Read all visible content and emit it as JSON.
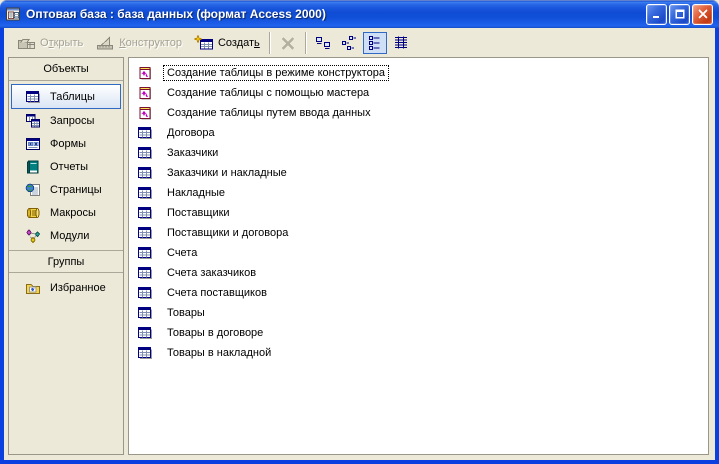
{
  "window": {
    "title": "Оптовая база : база данных (формат Access 2000)",
    "icons": {
      "app": "db-window-icon",
      "minimize": "minimize-icon",
      "maximize": "maximize-icon",
      "close": "close-icon"
    }
  },
  "toolbar": {
    "open": {
      "pre": "О",
      "accel": "т",
      "post": "крыть",
      "disabled": true,
      "icon": "open-table-icon"
    },
    "design": {
      "pre": "",
      "accel": "К",
      "post": "онструктор",
      "disabled": true,
      "icon": "design-view-icon"
    },
    "create": {
      "pre": "Создат",
      "accel": "ь",
      "post": "",
      "disabled": false,
      "icon": "new-object-icon"
    },
    "delete": {
      "disabled": true,
      "icon": "delete-x-icon"
    },
    "view_buttons": [
      {
        "name": "large-icons",
        "pressed": false
      },
      {
        "name": "small-icons",
        "pressed": false
      },
      {
        "name": "list",
        "pressed": true
      },
      {
        "name": "details",
        "pressed": false
      }
    ]
  },
  "sidebar": {
    "objects_header": "Объекты",
    "groups_header": "Группы",
    "items": [
      {
        "label": "Таблицы",
        "icon": "table-icon",
        "selected": true
      },
      {
        "label": "Запросы",
        "icon": "queries-icon",
        "selected": false
      },
      {
        "label": "Формы",
        "icon": "forms-icon",
        "selected": false
      },
      {
        "label": "Отчеты",
        "icon": "reports-icon",
        "selected": false
      },
      {
        "label": "Страницы",
        "icon": "pages-icon",
        "selected": false
      },
      {
        "label": "Макросы",
        "icon": "macros-icon",
        "selected": false
      },
      {
        "label": "Модули",
        "icon": "modules-icon",
        "selected": false
      }
    ],
    "group_items": [
      {
        "label": "Избранное",
        "icon": "favorites-folder-icon"
      }
    ]
  },
  "main": {
    "items": [
      {
        "label": "Создание таблицы в режиме конструктора",
        "icon": "new-table-wizard-icon",
        "focused": true
      },
      {
        "label": "Создание таблицы с помощью мастера",
        "icon": "new-table-wizard-icon",
        "focused": false
      },
      {
        "label": "Создание таблицы путем ввода данных",
        "icon": "new-table-wizard-icon",
        "focused": false
      },
      {
        "label": "Договора",
        "icon": "table-icon",
        "focused": false
      },
      {
        "label": "Заказчики",
        "icon": "table-icon",
        "focused": false
      },
      {
        "label": "Заказчики и накладные",
        "icon": "table-icon",
        "focused": false
      },
      {
        "label": "Накладные",
        "icon": "table-icon",
        "focused": false
      },
      {
        "label": "Поставщики",
        "icon": "table-icon",
        "focused": false
      },
      {
        "label": "Поставщики и договора",
        "icon": "table-icon",
        "focused": false
      },
      {
        "label": "Счета",
        "icon": "table-icon",
        "focused": false
      },
      {
        "label": "Счета заказчиков",
        "icon": "table-icon",
        "focused": false
      },
      {
        "label": "Счета поставщиков",
        "icon": "table-icon",
        "focused": false
      },
      {
        "label": "Товары",
        "icon": "table-icon",
        "focused": false
      },
      {
        "label": "Товары в договоре",
        "icon": "table-icon",
        "focused": false
      },
      {
        "label": "Товары в накладной",
        "icon": "table-icon",
        "focused": false
      }
    ]
  },
  "colors": {
    "titlebar_blue": "#1a57dd",
    "frame_blue": "#0c3fe0",
    "chrome_beige": "#ece9d8",
    "selection_border": "#316ac5",
    "close_red": "#d45527",
    "table_icon_navy": "#000080",
    "disabled_text": "#a5a192"
  }
}
